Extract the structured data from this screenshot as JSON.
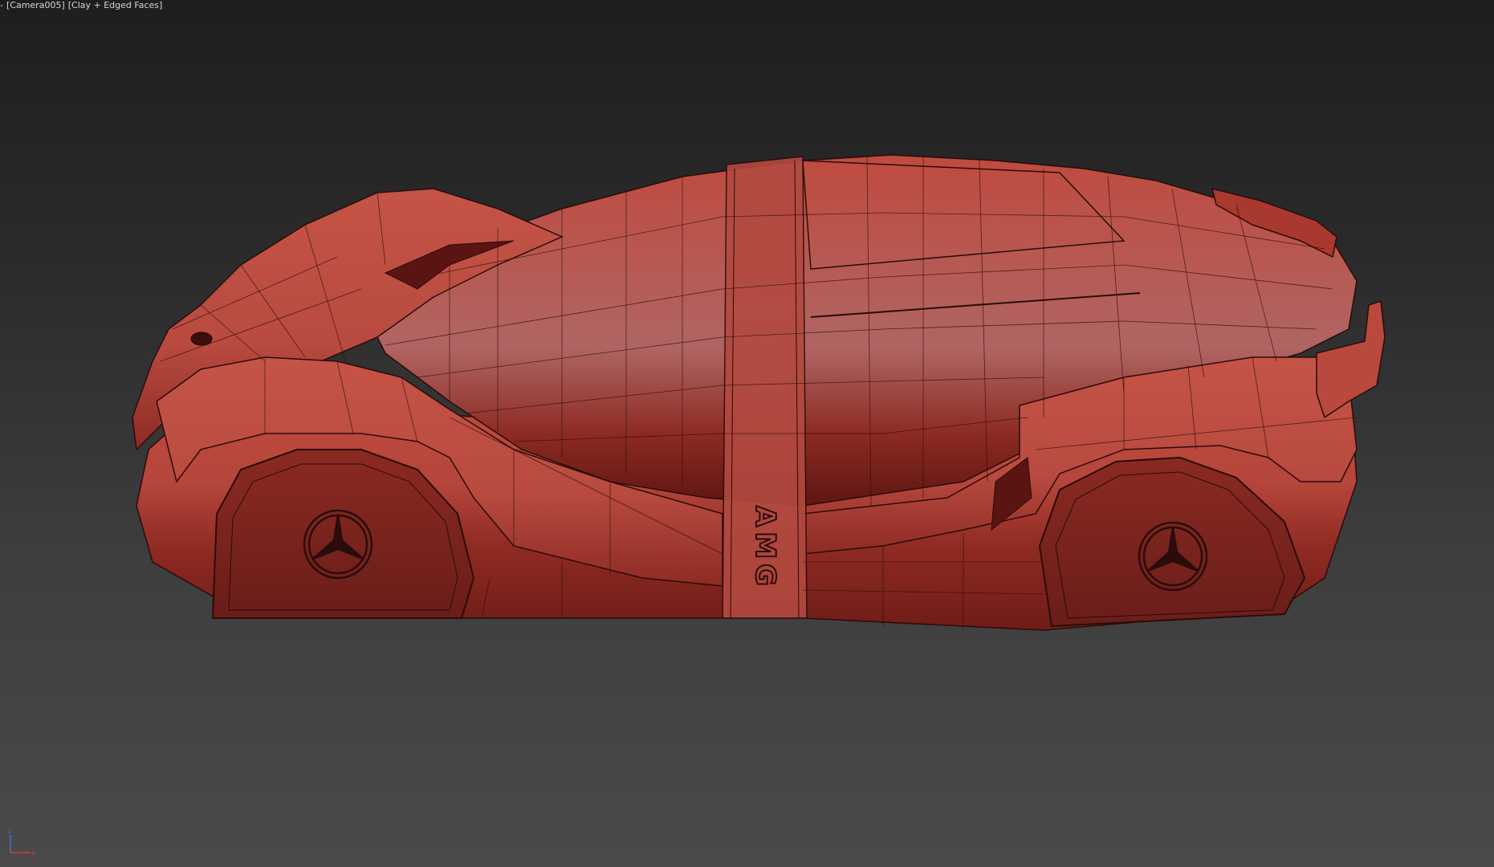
{
  "viewport": {
    "label_prefix": "-",
    "camera_label": "[Camera005]",
    "shading_label": "[Clay + Edged Faces]"
  },
  "model": {
    "logo_text": "AMG",
    "color_body": "#c2463a",
    "color_shadow": "#7a1f1b",
    "color_wire": "#2a0c0a"
  },
  "gizmo": {
    "z_axis": "z",
    "x_axis": "x"
  },
  "colors": {
    "axis_x": "#d83b3b",
    "axis_z": "#4a6be0"
  }
}
